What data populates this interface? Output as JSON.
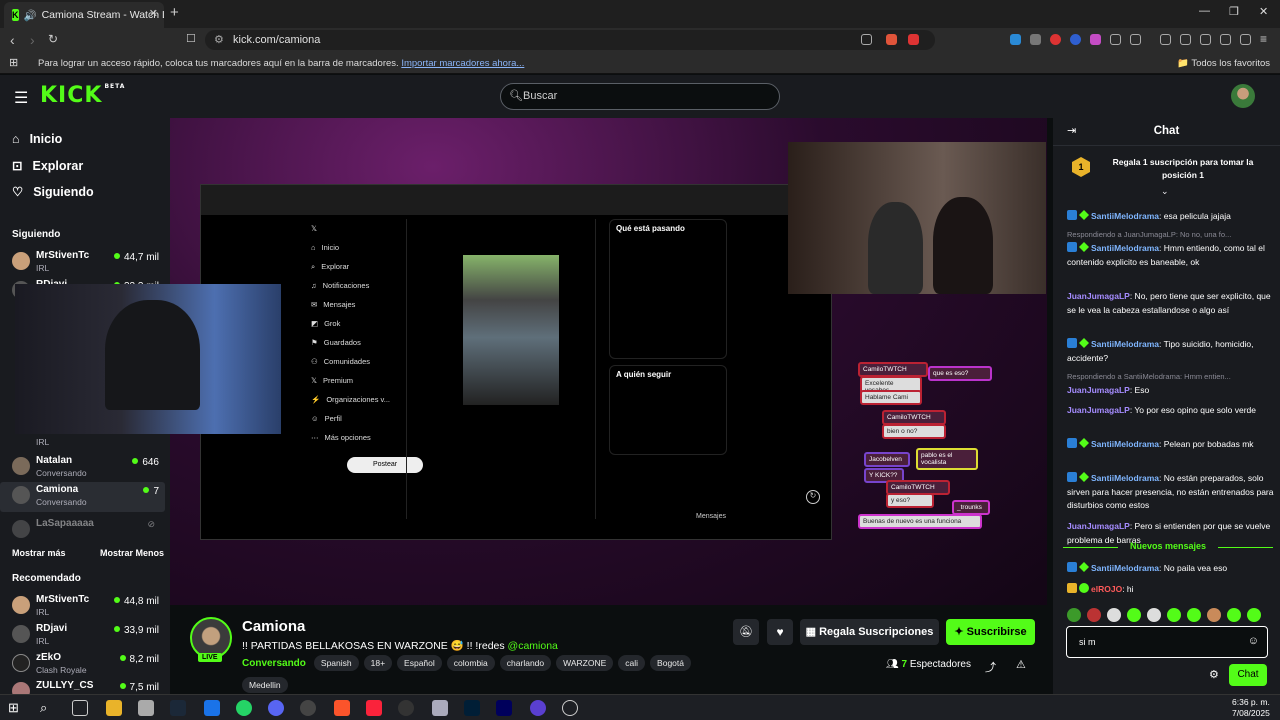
{
  "browser": {
    "tab_title": "Camiona Stream - Watch Live",
    "url": "kick.com/camiona",
    "bookmarks_msg": "Para lograr un acceso rápido, coloca tus marcadores aquí en la barra de marcadores.",
    "bookmarks_link": "Importar marcadores ahora...",
    "all_favorites": "Todos los favoritos"
  },
  "header": {
    "logo": "KICK",
    "logo_badge": "BETA",
    "search_placeholder": "Buscar"
  },
  "sidebar": {
    "nav": [
      {
        "label": "Inicio",
        "icon": "home-icon"
      },
      {
        "label": "Explorar",
        "icon": "compass-icon"
      },
      {
        "label": "Siguiendo",
        "icon": "heart-icon"
      }
    ],
    "following_title": "Siguiendo",
    "following": [
      {
        "name": "MrStivenTc",
        "category": "IRL",
        "viewers": "44,7 mil"
      },
      {
        "name": "RDjavi",
        "category": "",
        "viewers": "33,3 mil"
      },
      {
        "name": "",
        "category": "IRL",
        "viewers": ""
      },
      {
        "name": "Natalan",
        "category": "Conversando",
        "viewers": "646"
      },
      {
        "name": "Camiona",
        "category": "Conversando",
        "viewers": "7"
      },
      {
        "name": "LaSapaaaaa",
        "category": "",
        "viewers": ""
      }
    ],
    "show_more": "Mostrar más",
    "show_less": "Mostrar Menos",
    "recommended_title": "Recomendado",
    "recommended": [
      {
        "name": "MrStivenTc",
        "category": "IRL",
        "viewers": "44,8 mil"
      },
      {
        "name": "RDjavi",
        "category": "IRL",
        "viewers": "33,9 mil"
      },
      {
        "name": "zEkO",
        "category": "Clash Royale",
        "viewers": "8,2 mil"
      },
      {
        "name": "ZULLYY_CS",
        "category": "",
        "viewers": "7,5 mil"
      }
    ]
  },
  "video_overlay": {
    "x_nav": [
      "Inicio",
      "Explorar",
      "Notificaciones",
      "Mensajes",
      "Grok",
      "Guardados",
      "Comunidades",
      "Premium",
      "Organizaciones v...",
      "Perfil",
      "Más opciones"
    ],
    "post_button": "Postear",
    "trending_title": "Qué está pasando",
    "follow_title": "A quién seguir",
    "messages_label": "Mensajes",
    "popups": [
      "CamiloTWTCH",
      "Excelente vosabes",
      "Hablame Cami",
      "que es eso?",
      "CamiloTWTCH",
      "bien o no?",
      "Jacobelven",
      "pablo es el vocalista",
      "Y KICK??",
      "CamiloTWTCH",
      "y eso?",
      "Buenas de nuevo es una funciona",
      "_trounks"
    ]
  },
  "stream": {
    "channel": "Camiona",
    "live_label": "LIVE",
    "title": "!! PARTIDAS BELLAKOSAS EN WARZONE 😅 !! !redes",
    "title_mention": "@camiona",
    "category": "Conversando",
    "tags": [
      "Spanish",
      "18+",
      "Español",
      "colombia",
      "charlando",
      "WARZONE",
      "cali",
      "Bogotá"
    ],
    "tags_row2": [
      "Medellin"
    ],
    "gift_button": "Regala Suscripciones",
    "subscribe_button": "Suscribirse",
    "viewers_count": "7",
    "viewers_label": "Espectadores"
  },
  "chat": {
    "title": "Chat",
    "gift_rank": "1",
    "gift_prompt": "Regala 1 suscripción para tomar la posición 1",
    "messages": [
      {
        "reply": "",
        "user": "SantiiMelodrama",
        "text": ": esa pelicula jajaja",
        "color": "#7fb6ff"
      },
      {
        "reply": "Respondiendo a JuanJumagaLP: No no, una fo...",
        "user": "SantiiMelodrama",
        "text": ": Hmm entiendo, como tal el contenido explicito es baneable, ok",
        "color": "#7fb6ff"
      },
      {
        "reply": "",
        "user": "JuanJumagaLP",
        "text": ": No, pero tiene que ser explicito, que se le vea la cabeza estallandose o algo así",
        "color": "#a58cff"
      },
      {
        "reply": "",
        "user": "SantiiMelodrama",
        "text": ": Tipo suicidio, homicidio, accidente?",
        "color": "#7fb6ff"
      },
      {
        "reply": "Respondiendo a SantiiMelodrama: Hmm entien...",
        "user": "JuanJumagaLP",
        "text": ": Eso",
        "color": "#a58cff"
      },
      {
        "reply": "",
        "user": "JuanJumagaLP",
        "text": ": Yo por eso opino que solo verde",
        "color": "#a58cff"
      },
      {
        "reply": "",
        "user": "SantiiMelodrama",
        "text": ": Pelean por bobadas mk",
        "color": "#7fb6ff"
      },
      {
        "reply": "",
        "user": "SantiiMelodrama",
        "text": ": No están preparados, solo sirven para hacer presencia, no están entrenados para disturbios como estos",
        "color": "#7fb6ff"
      },
      {
        "reply": "",
        "user": "JuanJumagaLP",
        "text": ": Pero si entienden por que se vuelve problema de barras",
        "color": "#a58cff"
      }
    ],
    "new_messages_label": "Nuevos mensajes",
    "new_messages": [
      {
        "user": "SantiiMelodrama",
        "text": ": No paila vea eso",
        "color": "#7fb6ff"
      },
      {
        "user": "elROJO",
        "text": ": hi",
        "color": "#ff5a5a"
      }
    ],
    "input_value": "si m",
    "send_button": "Chat"
  },
  "taskbar": {
    "time": "6:36 p. m.",
    "date": "7/08/2025"
  }
}
